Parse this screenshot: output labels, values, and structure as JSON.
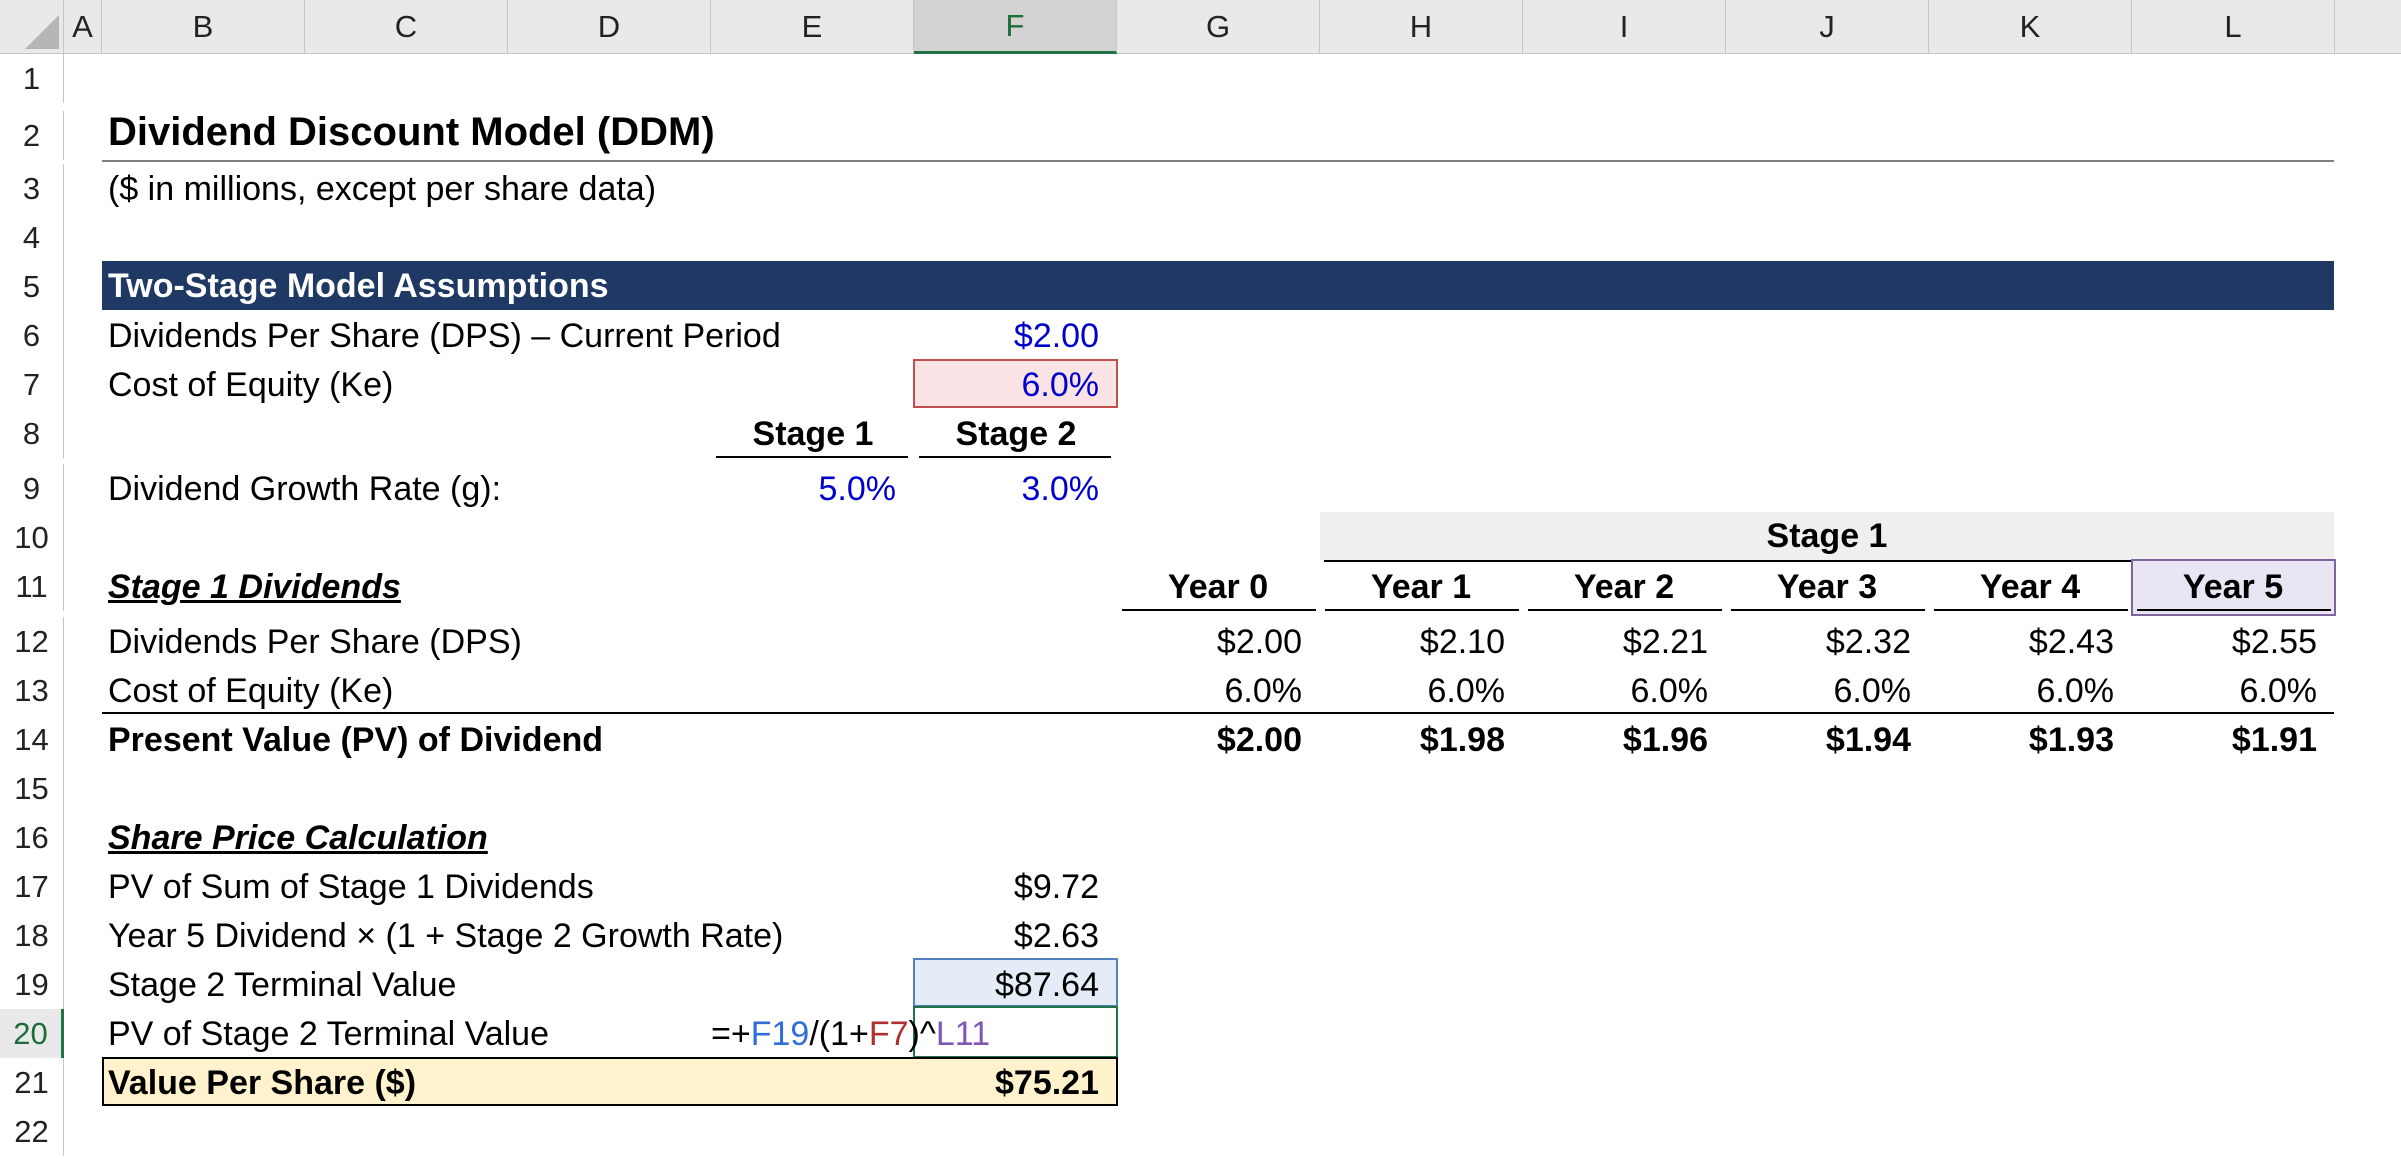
{
  "columns": [
    "A",
    "B",
    "C",
    "D",
    "E",
    "F",
    "G",
    "H",
    "I",
    "J",
    "K",
    "L"
  ],
  "rows": [
    "1",
    "2",
    "3",
    "4",
    "5",
    "6",
    "7",
    "8",
    "9",
    "10",
    "11",
    "12",
    "13",
    "14",
    "15",
    "16",
    "17",
    "18",
    "19",
    "20",
    "21",
    "22"
  ],
  "selected_column": "F",
  "selected_row": "20",
  "title": "Dividend Discount Model (DDM)",
  "subtitle": "($ in millions, except per share data)",
  "assumptions": {
    "header": "Two-Stage Model Assumptions",
    "dps_label": "Dividends Per Share (DPS) – Current Period",
    "dps_value": "$2.00",
    "ke_label": "Cost of Equity (Ke)",
    "ke_value": "6.0%",
    "stage1_label": "Stage 1",
    "stage2_label": "Stage 2",
    "growth_label": "Dividend Growth Rate (g):",
    "growth_stage1": "5.0%",
    "growth_stage2": "3.0%"
  },
  "stage1": {
    "band_label": "Stage 1",
    "section_label": "Stage 1 Dividends",
    "years": [
      "Year 0",
      "Year 1",
      "Year 2",
      "Year 3",
      "Year 4",
      "Year 5"
    ],
    "rows": [
      {
        "label": "Dividends Per Share (DPS)",
        "values": [
          "$2.00",
          "$2.10",
          "$2.21",
          "$2.32",
          "$2.43",
          "$2.55"
        ]
      },
      {
        "label": "Cost of Equity (Ke)",
        "values": [
          "6.0%",
          "6.0%",
          "6.0%",
          "6.0%",
          "6.0%",
          "6.0%"
        ]
      },
      {
        "label": "Present Value (PV) of Dividend",
        "values": [
          "$2.00",
          "$1.98",
          "$1.96",
          "$1.94",
          "$1.93",
          "$1.91"
        ]
      }
    ]
  },
  "share_price": {
    "section_label": "Share Price Calculation",
    "pv_sum_label": "PV of Sum of Stage 1 Dividends",
    "pv_sum_value": "$9.72",
    "y5_label": "Year 5 Dividend × (1 + Stage 2 Growth Rate)",
    "y5_value": "$2.63",
    "tv_label": "Stage 2 Terminal Value",
    "tv_value": "$87.64",
    "pv_tv_label": "PV of Stage 2 Terminal Value",
    "formula": {
      "p1": "=+",
      "ref1": "F19",
      "p2": "/(1+",
      "ref2": "F7",
      "p3": ")^",
      "ref3": "L11"
    },
    "vps_label": "Value Per Share ($)",
    "vps_value": "$75.21"
  },
  "colors": {
    "banner": "#1f3864",
    "input_blue": "#0000cc",
    "ref_blue": "#2f6fd6",
    "ref_red": "#b03030",
    "ref_purple": "#7f56b5",
    "vps_fill": "#fff2cc",
    "active_green": "#217346"
  }
}
